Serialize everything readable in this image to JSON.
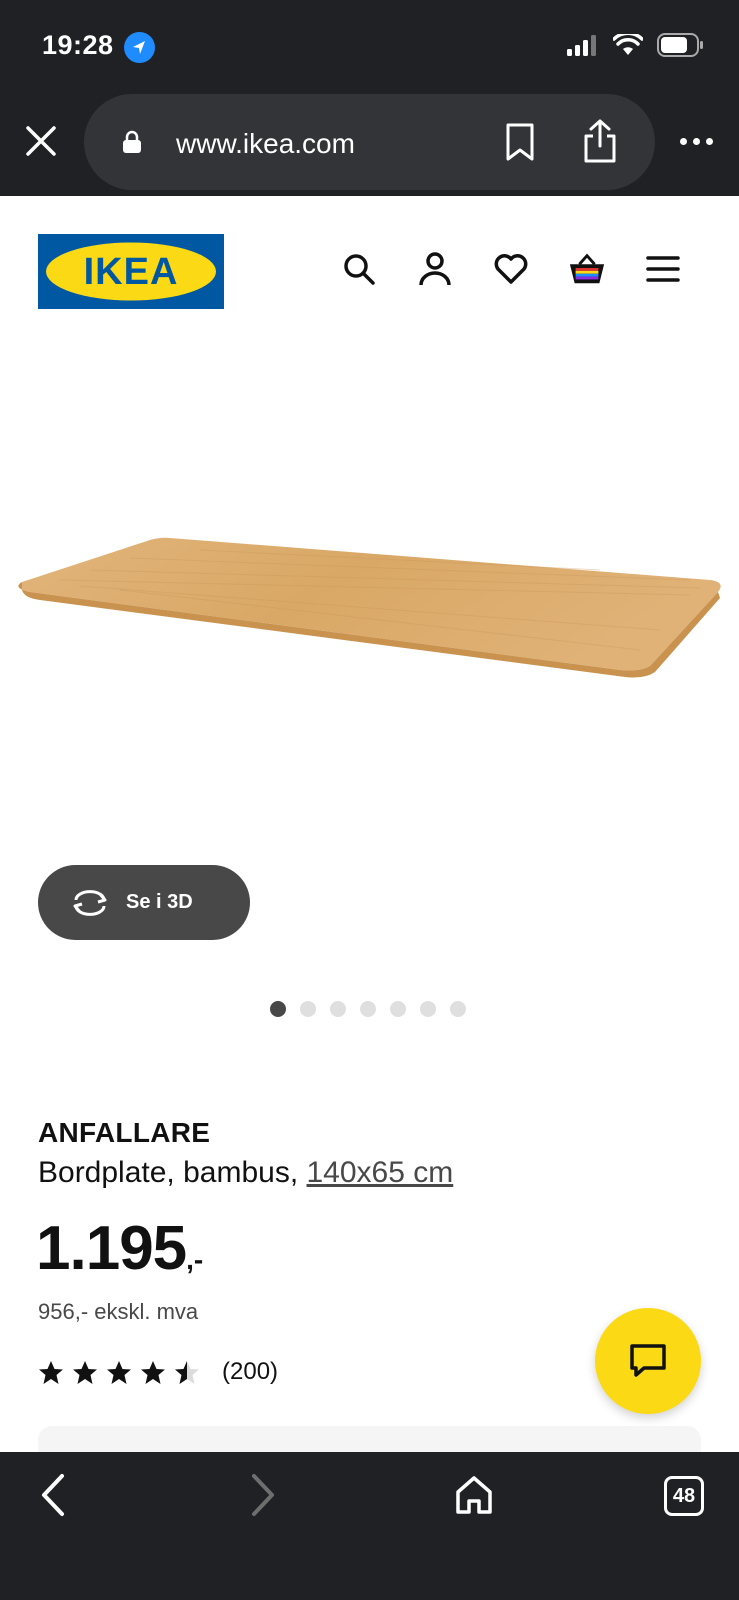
{
  "status_bar": {
    "time": "19:28"
  },
  "browser": {
    "url": "www.ikea.com",
    "tab_count": "48"
  },
  "logo": {
    "text": "IKEA",
    "colors": {
      "blue": "#0058a3",
      "yellow": "#fbd914"
    }
  },
  "header": {
    "icons": [
      "search-icon",
      "account-icon",
      "heart-icon",
      "basket-icon",
      "menu-icon"
    ]
  },
  "gallery": {
    "view_3d_label": "Se i 3D",
    "dot_count": 7,
    "active_index": 0
  },
  "product": {
    "name": "ANFALLARE",
    "description": "Bordplate, bambus, ",
    "dimensions": "140x65 cm",
    "price": "1.195",
    "price_suffix": ",-",
    "price_ex_vat": "956,- ekskl. mva",
    "rating": 4.5,
    "rating_count": "(200)"
  },
  "colors": {
    "chrome_bg": "#202124",
    "button_dark": "#484848",
    "chat_yellow": "#fbd914"
  }
}
